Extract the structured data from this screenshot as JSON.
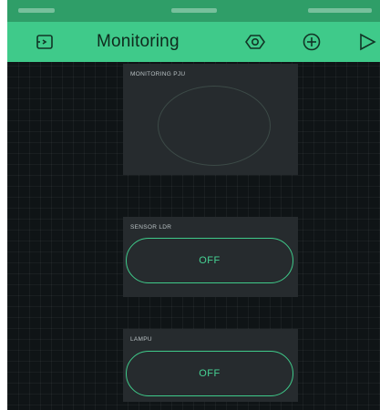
{
  "toolbar": {
    "title": "Monitoring",
    "icons": [
      "project-icon",
      "settings-icon",
      "add-widget-icon",
      "play-icon"
    ]
  },
  "widgets": {
    "gauge": {
      "label": "MONITORING PJU"
    },
    "ldr": {
      "label": "SENSOR LDR",
      "button_label": "OFF"
    },
    "lamp": {
      "label": "LAMPU",
      "button_label": "OFF"
    }
  },
  "colors": {
    "accent": "#3fca8a",
    "status_bar": "#2f9e68",
    "background": "#0f1416",
    "widget_bg": "#262b2e",
    "button_text": "#46d394"
  }
}
